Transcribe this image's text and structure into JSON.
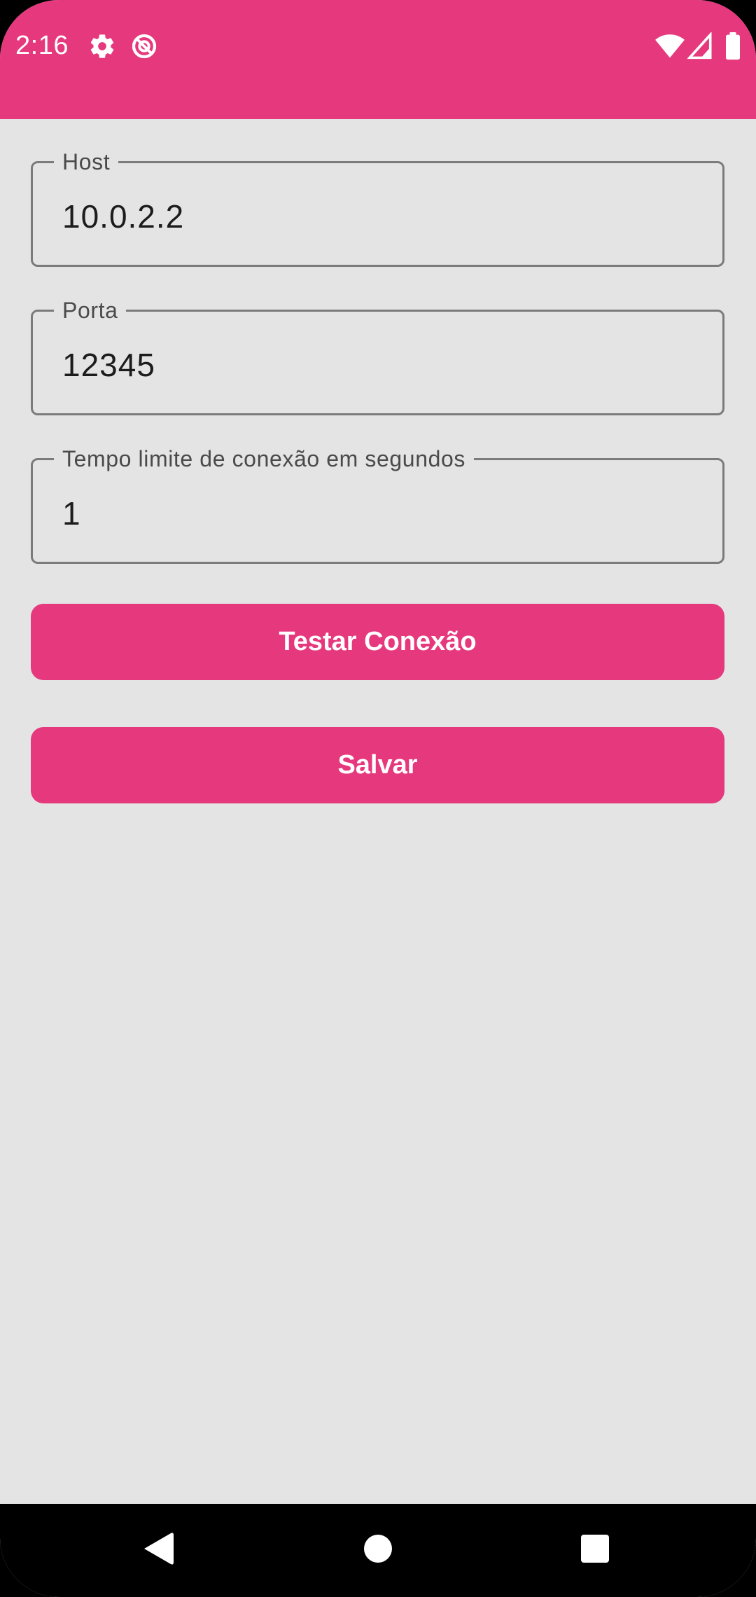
{
  "status_bar": {
    "time": "2:16",
    "background": "#e6387d",
    "icons": [
      "gear-icon",
      "data-saver-icon",
      "wifi-icon",
      "signal-icon",
      "battery-icon"
    ]
  },
  "form": {
    "host": {
      "label": "Host",
      "value": "10.0.2.2"
    },
    "port": {
      "label": "Porta",
      "value": "12345"
    },
    "timeout": {
      "label": "Tempo limite de conexão em segundos",
      "value": "1"
    }
  },
  "buttons": {
    "test_label": "Testar Conexão",
    "save_label": "Salvar"
  },
  "navigation": {
    "icons": [
      "back-icon",
      "home-icon",
      "recents-icon"
    ]
  },
  "colors": {
    "accent": "#e6387d",
    "background": "#e4e4e4",
    "field_border": "#7b7b7b"
  }
}
